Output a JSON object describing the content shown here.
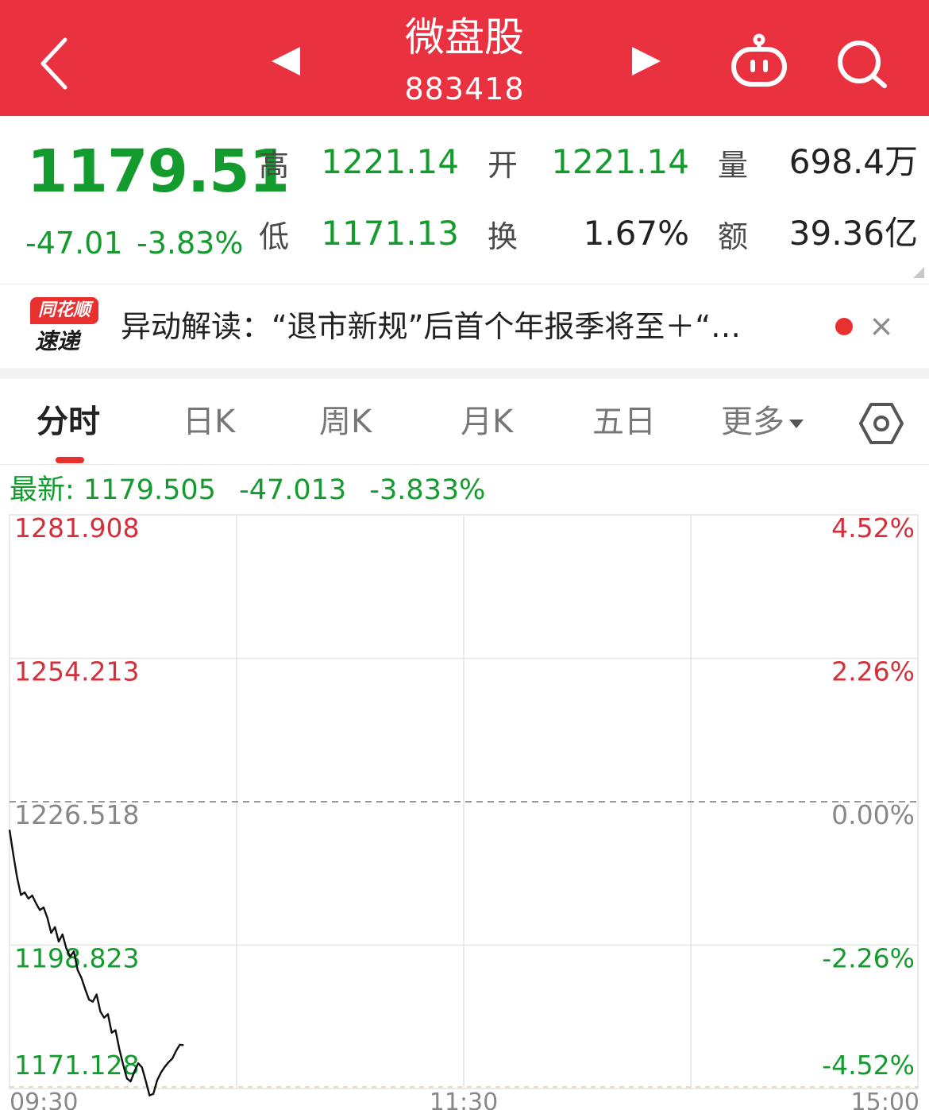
{
  "header": {
    "title": "微盘股",
    "code": "883418",
    "back_icon": "chevron-left-icon",
    "prev_icon": "triangle-left-icon",
    "next_icon": "triangle-right-icon",
    "robot_icon": "robot-assistant-icon",
    "search_icon": "search-icon"
  },
  "quote": {
    "price": "1179.51",
    "change": "-47.01",
    "change_pct": "-3.83%",
    "high_label": "高",
    "high": "1221.14",
    "open_label": "开",
    "open": "1221.14",
    "volume_label": "量",
    "volume": "698.4万",
    "low_label": "低",
    "low": "1171.13",
    "turnover_label": "换",
    "turnover": "1.67%",
    "amount_label": "额",
    "amount": "39.36亿"
  },
  "news": {
    "logo_top": "同花顺",
    "logo_bottom": "速递",
    "text": "异动解读：“退市新规”后首个年报季将至＋“…",
    "close": "×"
  },
  "tabs": {
    "items": [
      "分时",
      "日K",
      "周K",
      "月K",
      "五日",
      "更多"
    ],
    "active": "分时",
    "settings_icon": "hexagon-settings-icon"
  },
  "latest": {
    "label": "最新: 1179.505",
    "change": "-47.013",
    "pct": "-3.833%"
  },
  "colors": {
    "header_red": "#ea3140",
    "up_red": "#d42f3a",
    "down_green": "#139c2d"
  },
  "chart_data": {
    "type": "line",
    "y_ticks_left": [
      "1281.908",
      "1254.213",
      "1226.518",
      "1198.823",
      "1171.128"
    ],
    "y_ticks_right": [
      "4.52%",
      "2.26%",
      "0.00%",
      "-2.26%",
      "-4.52%"
    ],
    "x_ticks": [
      "09:30",
      "11:30",
      "15:00"
    ],
    "ylim": [
      1171.128,
      1281.908
    ],
    "prev_close": 1226.518,
    "grid": true,
    "series": [
      {
        "minutes": [
          0,
          1,
          2,
          3,
          4,
          5,
          6,
          7,
          8,
          9,
          10,
          11,
          12,
          13,
          14,
          15,
          16,
          17,
          18,
          19,
          20,
          21,
          22,
          23,
          24,
          25,
          26,
          27,
          28,
          29,
          30,
          31,
          32,
          33,
          34,
          35,
          36,
          37,
          38,
          39,
          40,
          41,
          42,
          43,
          44,
          45,
          46
        ],
        "values": [
          1221.1,
          1216.3,
          1211.9,
          1208.5,
          1209.0,
          1207.8,
          1208.4,
          1206.9,
          1205.6,
          1206.1,
          1204.1,
          1201.2,
          1202.3,
          1199.5,
          1200.9,
          1198.2,
          1196.6,
          1197.6,
          1194.0,
          1192.5,
          1190.3,
          1188.3,
          1187.9,
          1189.3,
          1186.0,
          1184.8,
          1185.5,
          1181.9,
          1182.4,
          1178.8,
          1175.8,
          1173.1,
          1172.5,
          1174.4,
          1176.0,
          1175.2,
          1172.6,
          1169.8,
          1170.1,
          1172.7,
          1174.2,
          1175.3,
          1176.2,
          1176.9,
          1178.4,
          1179.6,
          1179.5
        ]
      }
    ]
  }
}
